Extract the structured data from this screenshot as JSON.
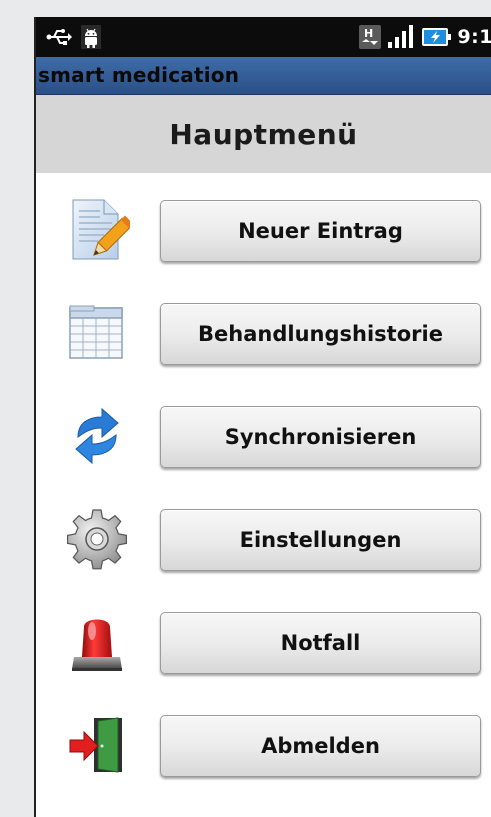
{
  "status_bar": {
    "time": "9:1",
    "icons": [
      "usb-icon",
      "android-debug-icon",
      "h-data-icon",
      "signal-icon",
      "battery-charging-icon"
    ]
  },
  "app": {
    "title": "smart medication"
  },
  "screen": {
    "title": "Hauptmenü"
  },
  "menu": [
    {
      "label": "Neuer Eintrag",
      "icon": "edit-document-icon"
    },
    {
      "label": "Behandlungshistorie",
      "icon": "table-calendar-icon"
    },
    {
      "label": "Synchronisieren",
      "icon": "sync-arrows-icon"
    },
    {
      "label": "Einstellungen",
      "icon": "gear-icon"
    },
    {
      "label": "Notfall",
      "icon": "siren-icon"
    },
    {
      "label": "Abmelden",
      "icon": "exit-door-icon"
    }
  ],
  "colors": {
    "titlebar": "#2b4f87",
    "header_bg": "#d6d6d6",
    "sync_blue": "#2a7bd6",
    "alarm_red": "#d31c1c"
  }
}
